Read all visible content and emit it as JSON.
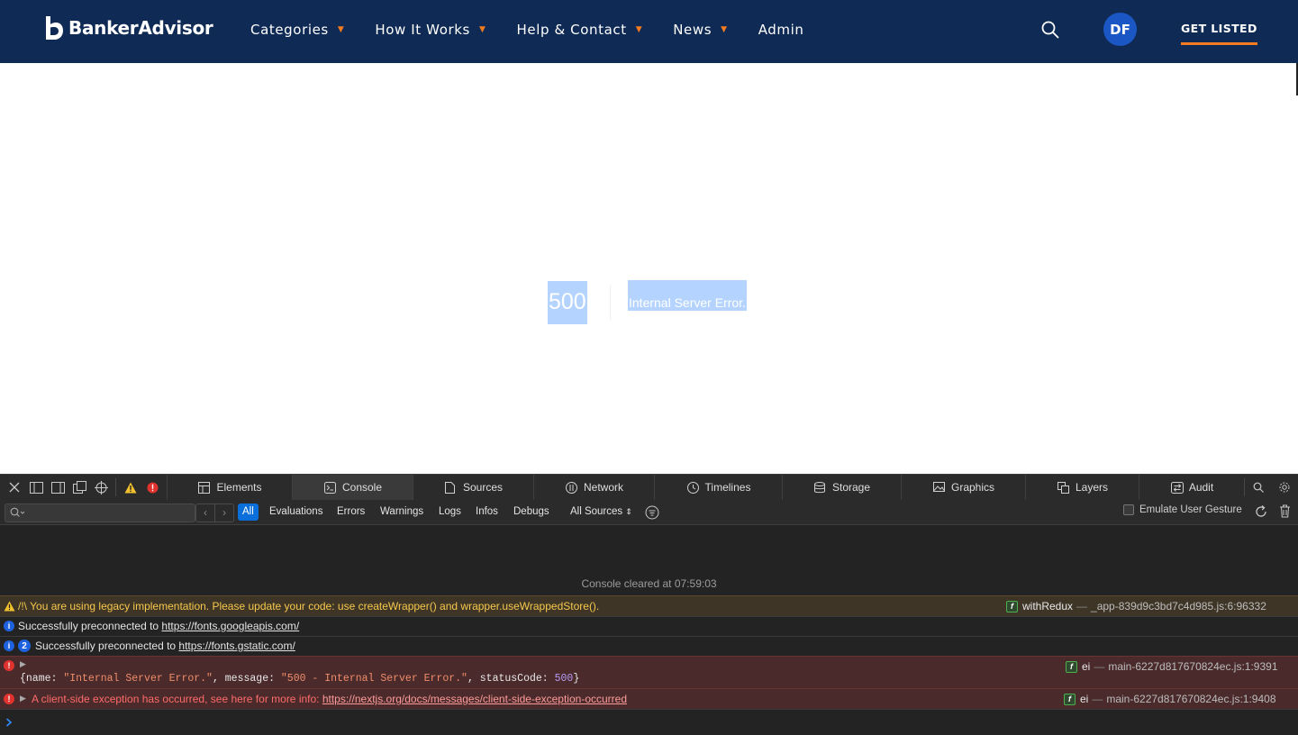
{
  "brand": {
    "name": "BankerAdvisor"
  },
  "nav": {
    "items": [
      {
        "label": "Categories",
        "caret": true
      },
      {
        "label": "How It Works",
        "caret": true
      },
      {
        "label": "Help & Contact",
        "caret": true
      },
      {
        "label": "News",
        "caret": true
      },
      {
        "label": "Admin",
        "caret": false
      }
    ],
    "avatar_initials": "DF",
    "cta_label": "GET LISTED"
  },
  "error_page": {
    "code": "500",
    "message": "Internal Server Error."
  },
  "devtools": {
    "tabs": [
      {
        "label": "Elements",
        "icon": "elements-icon",
        "active": false
      },
      {
        "label": "Console",
        "icon": "console-icon",
        "active": true
      },
      {
        "label": "Sources",
        "icon": "sources-icon",
        "active": false
      },
      {
        "label": "Network",
        "icon": "network-icon",
        "active": false
      },
      {
        "label": "Timelines",
        "icon": "timelines-icon",
        "active": false
      },
      {
        "label": "Storage",
        "icon": "storage-icon",
        "active": false
      },
      {
        "label": "Graphics",
        "icon": "graphics-icon",
        "active": false
      },
      {
        "label": "Layers",
        "icon": "layers-icon",
        "active": false
      },
      {
        "label": "Audit",
        "icon": "audit-icon",
        "active": false
      }
    ],
    "filter": {
      "placeholder": "",
      "levels": [
        "All",
        "Evaluations",
        "Errors",
        "Warnings",
        "Logs",
        "Infos",
        "Debugs"
      ],
      "active_level": "All",
      "sources_label": "All Sources",
      "emulate_label": "Emulate User Gesture"
    },
    "console": {
      "cleared_text": "Console cleared at 07:59:03",
      "messages": [
        {
          "level": "warning",
          "text": "/!\\ You are using legacy implementation. Please update your code: use createWrapper() and wrapper.useWrappedStore().",
          "source_fn": "withRedux",
          "source_loc": "_app-839d9c3bd7c4d985.js:6:96332"
        },
        {
          "level": "info",
          "text": "Successfully preconnected to ",
          "link": "https://fonts.googleapis.com/"
        },
        {
          "level": "info",
          "count": "2",
          "text": "Successfully preconnected to ",
          "link": "https://fonts.gstatic.com/"
        },
        {
          "level": "error",
          "object": {
            "open": "{",
            "name_key": "name",
            "name_val": "\"Internal Server Error.\"",
            "message_key": "message",
            "message_val": "\"500 - Internal Server Error.\"",
            "status_key": "statusCode",
            "status_val": "500",
            "close": "}"
          },
          "source_fn": "ei",
          "source_loc": "main-6227d817670824ec.js:1:9391"
        },
        {
          "level": "error",
          "text": "A client-side exception has occurred, see here for more info: ",
          "link": "https://nextjs.org/docs/messages/client-side-exception-occurred",
          "source_fn": "ei",
          "source_loc": "main-6227d817670824ec.js:1:9408"
        }
      ]
    }
  }
}
